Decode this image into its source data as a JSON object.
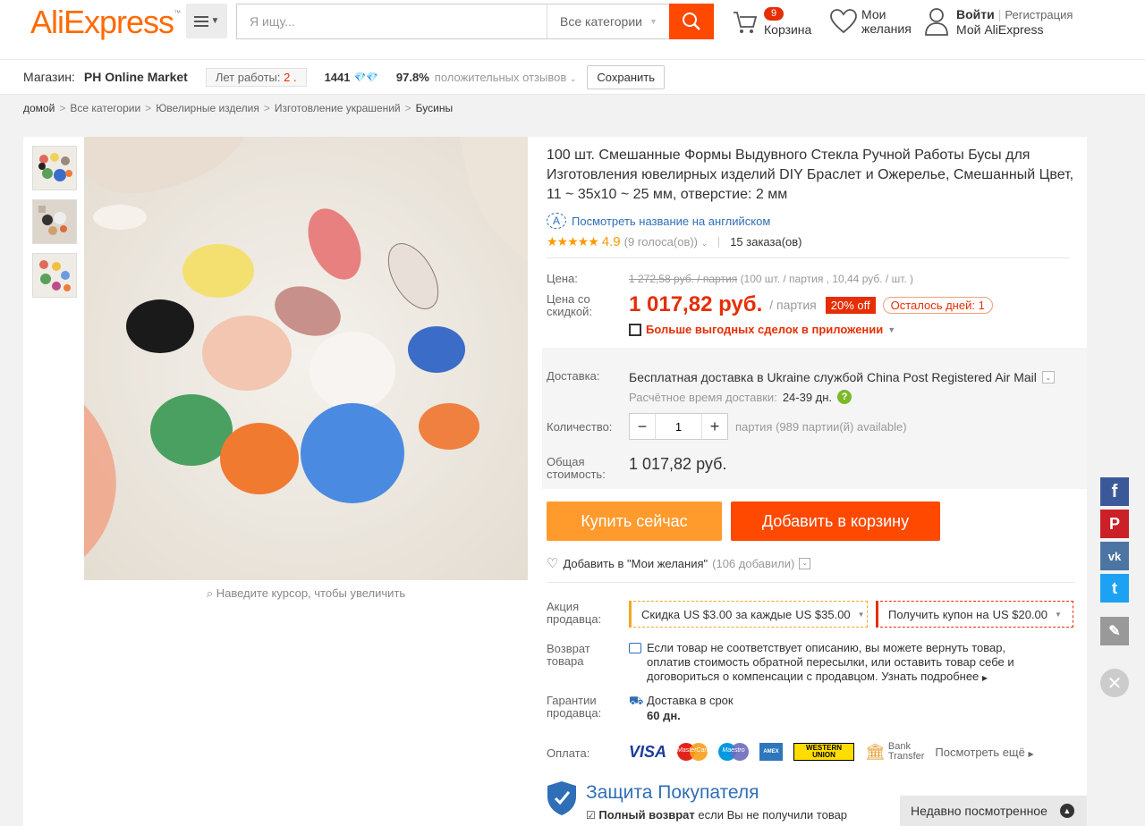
{
  "header": {
    "logo": "AliExpress",
    "logo_tm": "™",
    "search_placeholder": "Я ищу...",
    "category": "Все категории",
    "cart_count": "9",
    "cart_label": "Корзина",
    "wishlist_label": "Мои желания",
    "login": "Войти",
    "register": "Регистрация",
    "my_ali": "Мой AliExpress"
  },
  "store": {
    "label": "Магазин:",
    "name": "PH Online Market",
    "years_label": "Лет работы:",
    "years_value": "2 .",
    "score": "1441",
    "feedback_pct": "97.8%",
    "feedback_label": "положительных отзывов",
    "save": "Сохранить"
  },
  "breadcrumb": {
    "home": "домой",
    "items": [
      "Все категории",
      "Ювелирные изделия",
      "Изготовление украшений"
    ],
    "current": "Бусины"
  },
  "gallery": {
    "zoom_hint": "Наведите курсор, чтобы увеличить"
  },
  "product": {
    "title": "100 шт. Смешанные Формы Выдувного Стекла Ручной Работы Бусы для Изготовления ювелирных изделий DIY Браслет и Ожерелье, Смешанный Цвет, 11 ~ 35x10 ~ 25 мм, отверстие: 2 мм",
    "translate": "Посмотреть название на английском",
    "rating": "4.9",
    "votes": "(9 голоса(ов))",
    "orders": "15 заказа(ов)"
  },
  "price": {
    "label": "Цена:",
    "old": "1 272,58 руб. / партия",
    "old_detail": "(100 шт. / партия , 10,44 руб. / шт. )",
    "disc_label": "Цена со скидкой:",
    "value": "1 017,82 руб.",
    "unit": "/ партия",
    "off": "20% off",
    "days_left": "Осталось дней: 1",
    "app_deals": "Больше выгодных сделок в приложении"
  },
  "shipping": {
    "label": "Доставка:",
    "text_pre": "Бесплатная доставка в",
    "country": "Ukraine",
    "text_mid": "службой",
    "service": "China Post Registered Air Mail",
    "time_label": "Расчётное время доставки:",
    "time_value": "24-39 дн."
  },
  "quantity": {
    "label": "Количество:",
    "value": "1",
    "available": "партия (989 партии(й) available)"
  },
  "total": {
    "label": "Общая стоимость:",
    "value": "1 017,82 руб."
  },
  "actions": {
    "buy_now": "Купить сейчас",
    "add_to_cart": "Добавить в корзину",
    "wishlist": "Добавить в \"Мои желания\"",
    "wishlist_count": "(106 добавили)"
  },
  "promo": {
    "label": "Акция продавца:",
    "discount_pre": "Скидка",
    "discount_amt": "US $3.00",
    "discount_mid": "за каждые",
    "discount_min": "US $35.00",
    "coupon_pre": "Получить купон на",
    "coupon_amt": "US $20.00"
  },
  "returns": {
    "label": "Возврат товара",
    "text": "Если товар не соответствует описанию, вы можете вернуть товар, оплатив стоимость обратной пересылки, или оставить товар себе и договориться о компенсации с продавцом.",
    "more": "Узнать подробнее"
  },
  "guarantee": {
    "label": "Гарантии продавца:",
    "text": "Доставка в срок",
    "days": "60 дн."
  },
  "payment": {
    "label": "Оплата:",
    "visa": "VISA",
    "mastercard": "MasterCard",
    "maestro": "Maestro",
    "amex": "AMEX",
    "wu": "WESTERN UNION",
    "bank_line1": "Bank",
    "bank_line2": "Transfer",
    "more": "Посмотреть ещё"
  },
  "protection": {
    "title": "Защита Покупателя",
    "refund_bold": "Полный возврат",
    "refund_text": "если Вы не получили товар"
  },
  "social": {
    "facebook": "f",
    "pinterest": "P",
    "vk": "vk",
    "twitter": "t"
  },
  "recent": {
    "label": "Недавно посмотренное"
  },
  "colors": {
    "brand": "#ff6a00",
    "buy": "#ff9a2d",
    "cart": "#ff4800",
    "price": "#e62e04",
    "link": "#2f6fb7"
  }
}
